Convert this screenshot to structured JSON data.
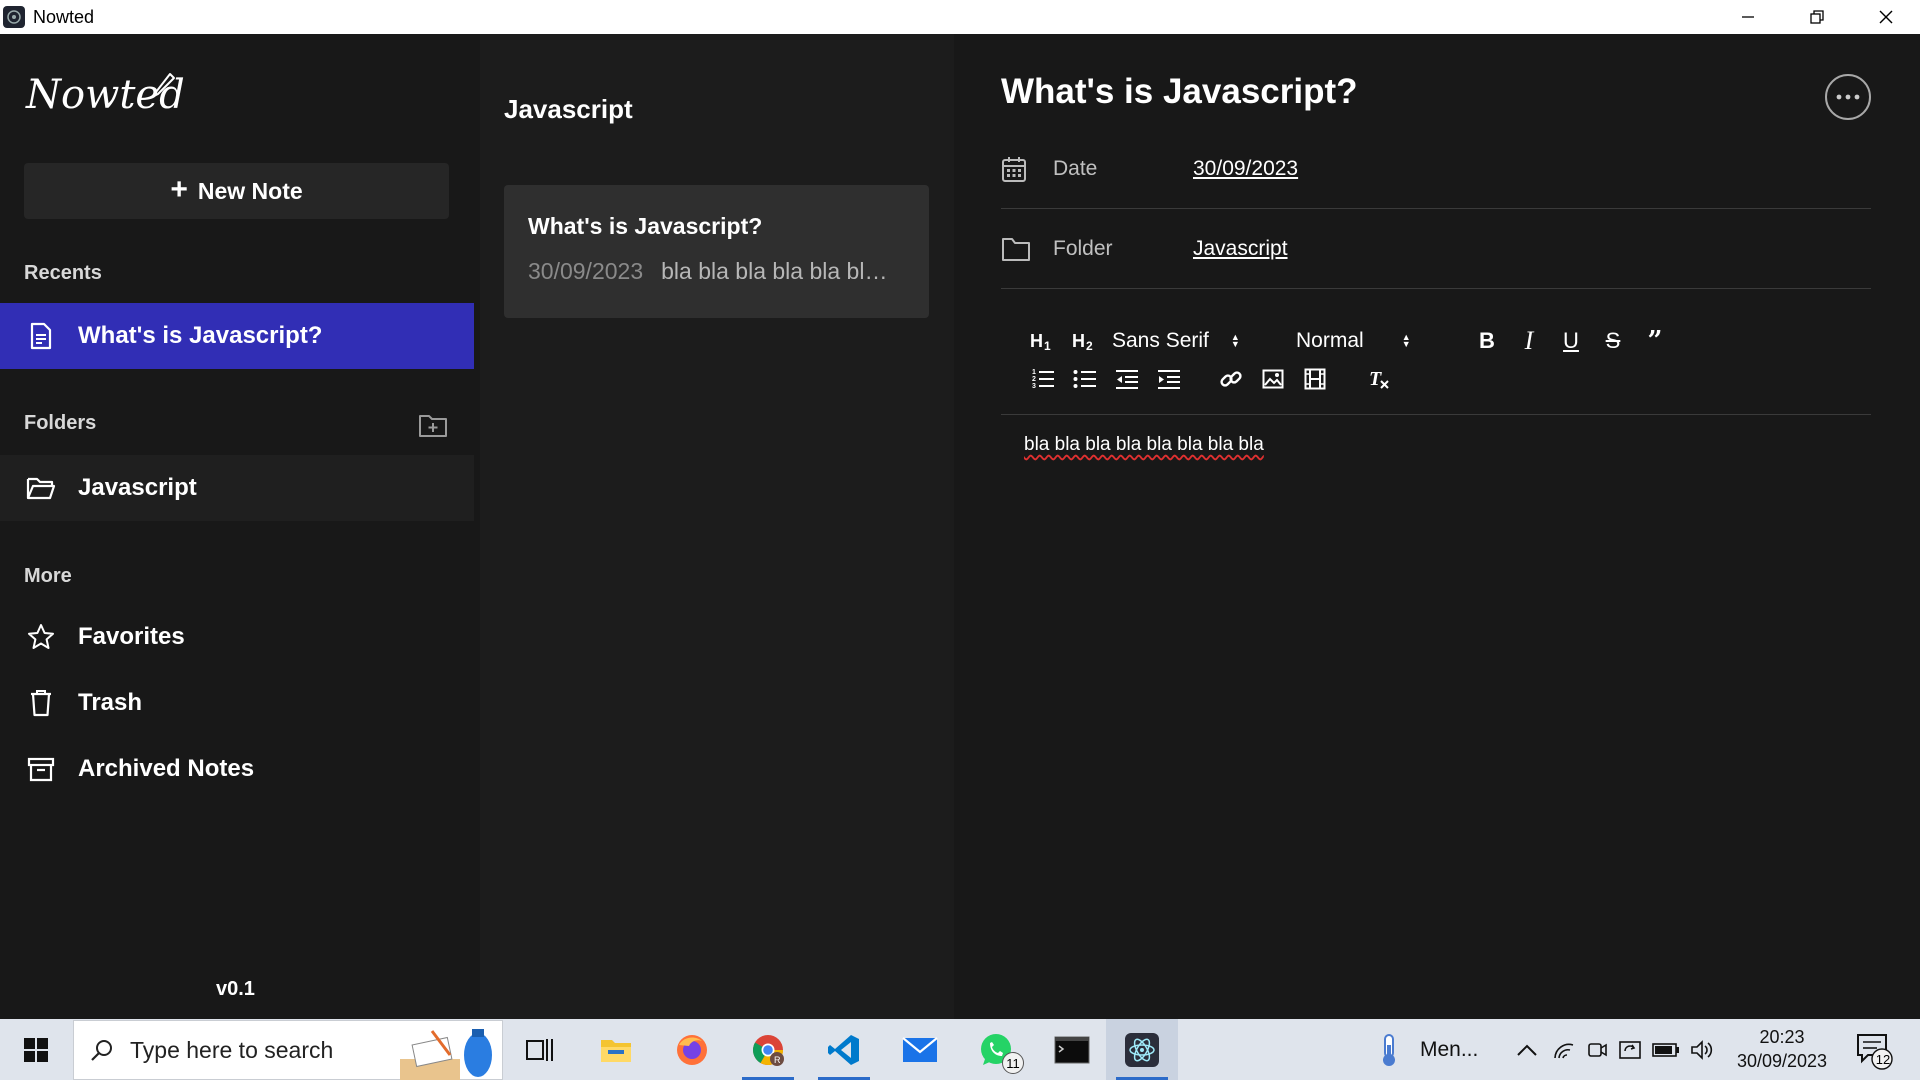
{
  "window": {
    "title": "Nowted"
  },
  "sidebar": {
    "logo": "Nowted",
    "new_note_label": "New Note",
    "recents_heading": "Recents",
    "recents": [
      {
        "label": "What's is Javascript?",
        "icon": "document-icon",
        "active": true
      }
    ],
    "folders_heading": "Folders",
    "folders": [
      {
        "label": "Javascript",
        "icon": "folder-open-icon"
      }
    ],
    "more_heading": "More",
    "more": [
      {
        "label": "Favorites",
        "icon": "star-icon"
      },
      {
        "label": "Trash",
        "icon": "trash-icon"
      },
      {
        "label": "Archived Notes",
        "icon": "archive-icon"
      }
    ],
    "version": "v0.1"
  },
  "notelist": {
    "title": "Javascript",
    "notes": [
      {
        "title": "What's is Javascript?",
        "date": "30/09/2023",
        "preview": "bla bla bla bla bla bl…"
      }
    ]
  },
  "editor": {
    "title": "What's is Javascript?",
    "date_label": "Date",
    "date_value": "30/09/2023",
    "folder_label": "Folder",
    "folder_value": "Javascript",
    "font_family": "Sans Serif",
    "font_size": "Normal",
    "body": "bla bla bla bla bla bla bla bla"
  },
  "taskbar": {
    "search_placeholder": "Type here to search",
    "whatsapp_badge": "11",
    "tray_app_label": "Men...",
    "time": "20:23",
    "date": "30/09/2023",
    "notification_count": "12"
  },
  "colors": {
    "accent": "#312eb5",
    "background": "#181818",
    "card": "#2f2f2f"
  }
}
